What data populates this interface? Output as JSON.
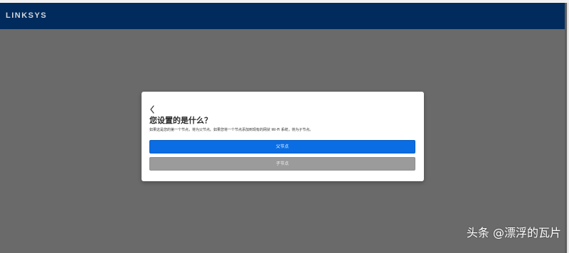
{
  "window": {
    "brand": "LINKSYS"
  },
  "dialog": {
    "back_icon": "chevron-left-icon",
    "title": "您设置的是什么？",
    "description": "如果这是您的第一个节点，将为父节点。如果您将一个节点添加到现有的网状 Wi-Fi 系统，将为子节点。",
    "primary_button_label": "父节点",
    "secondary_button_label": "子节点"
  },
  "watermark": {
    "text": "头条 @漂浮的瓦片"
  },
  "colors": {
    "top_bar": "#002b5c",
    "overlay": "#6a6a6a",
    "primary_button": "#0a6de4",
    "secondary_button": "#9b9b9b"
  }
}
